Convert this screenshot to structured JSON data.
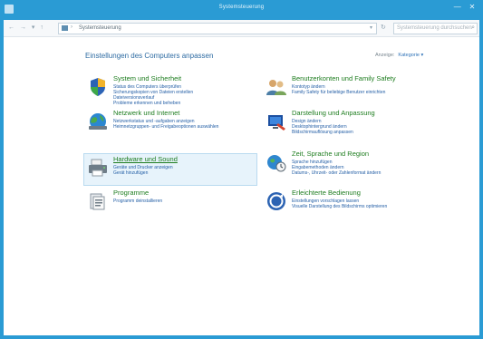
{
  "window": {
    "title": "Systemsteuerung",
    "controls": {
      "minimize": "—",
      "close": "✕"
    }
  },
  "address_bar": {
    "nav": {
      "back": "←",
      "forward": "→",
      "recent": "▾",
      "up": "↑"
    },
    "crumb": "Systemsteuerung",
    "search_placeholder": "Systemsteuerung durchsuchen"
  },
  "content": {
    "heading": "Einstellungen des Computers anpassen",
    "view_by": {
      "label": "Anzeige:",
      "value": "Kategorie ▾"
    },
    "categories": [
      {
        "title": "System und Sicherheit",
        "icon": "shield-icon",
        "links": [
          "Status des Computers überprüfen",
          "Sicherungskopien von Dateien erstellen",
          "Dateiversionsverlauf",
          "Probleme erkennen und beheben"
        ]
      },
      {
        "title": "Benutzerkonten und Family Safety",
        "icon": "users-icon",
        "links": [
          "Kontotyp ändern",
          "Family Safety für beliebige Benutzer einrichten"
        ]
      },
      {
        "title": "Netzwerk und Internet",
        "icon": "globe-network-icon",
        "links": [
          "Netzwerkstatus und -aufgaben anzeigen",
          "Heimnetzgruppen- und Freigabeoptionen auswählen"
        ]
      },
      {
        "title": "Darstellung und Anpassung",
        "icon": "display-icon",
        "links": [
          "Design ändern",
          "Desktophintergrund ändern",
          "Bildschirmauflösung anpassen"
        ]
      },
      {
        "title": "Hardware und Sound",
        "icon": "printer-icon",
        "links": [
          "Geräte und Drucker anzeigen",
          "Gerät hinzufügen"
        ]
      },
      {
        "title": "Zeit, Sprache und Region",
        "icon": "clock-globe-icon",
        "links": [
          "Sprache hinzufügen",
          "Eingabemethoden ändern",
          "Datums-, Uhrzeit- oder Zahlenformat ändern"
        ]
      },
      {
        "title": "Programme",
        "icon": "programs-icon",
        "links": [
          "Programm deinstallieren"
        ]
      },
      {
        "title": "Erleichterte Bedienung",
        "icon": "accessibility-icon",
        "links": [
          "Einstellungen vorschlagen lassen",
          "Visuelle Darstellung des Bildschirms optimieren"
        ]
      }
    ]
  },
  "colors": {
    "frame": "#2a9bd4",
    "category_title": "#1e7d1f",
    "link": "#245fa6",
    "heading": "#2f6ca3"
  }
}
